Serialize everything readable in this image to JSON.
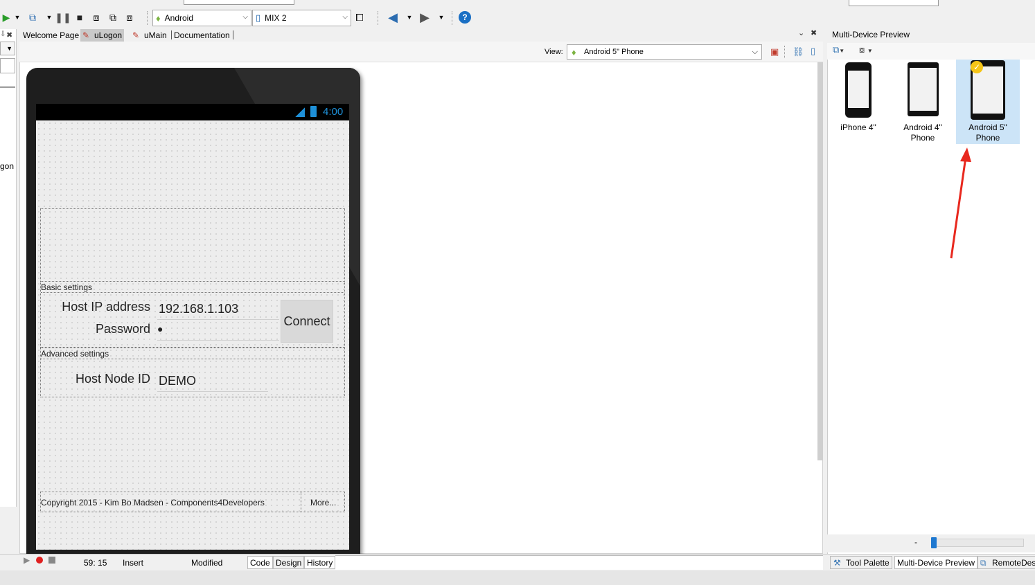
{
  "toolbar": {
    "platform": "Android",
    "device": "MIX 2"
  },
  "tabs": [
    {
      "label": "Welcome Page"
    },
    {
      "label": "uLogon"
    },
    {
      "label": "uMain"
    },
    {
      "label": "Documentation"
    }
  ],
  "leftstrip": {
    "fragment": "gon"
  },
  "viewbar": {
    "label": "View:",
    "selected": "Android 5\" Phone"
  },
  "phone": {
    "time": "4:00"
  },
  "form": {
    "basic_group": "Basic settings",
    "host_ip_label": "Host IP address",
    "host_ip_value": "192.168.1.103",
    "password_label": "Password",
    "password_value": "●",
    "connect_label": "Connect",
    "advanced_group": "Advanced settings",
    "node_id_label": "Host Node ID",
    "node_id_value": "DEMO",
    "copyright": "Copyright 2015 - Kim Bo Madsen - Components4Developers",
    "more_label": "More..."
  },
  "preview": {
    "title": "Multi-Device Preview",
    "devices": [
      {
        "label1": "iPhone 4\"",
        "label2": ""
      },
      {
        "label1": "Android 4\"",
        "label2": "Phone"
      },
      {
        "label1": "Android 5\"",
        "label2": "Phone"
      }
    ],
    "zoom_minus": "-"
  },
  "status": {
    "position": "59: 15",
    "mode": "Insert",
    "state": "Modified",
    "tab_code": "Code",
    "tab_design": "Design",
    "tab_history": "History"
  },
  "panel_tabs": {
    "tool_palette": "Tool Palette",
    "multi_device": "Multi-Device Preview",
    "remote": "RemoteDes"
  },
  "colors": {
    "accent": "#1e90d8",
    "selection": "#cce4f7",
    "annotation_arrow": "#e8281e"
  }
}
